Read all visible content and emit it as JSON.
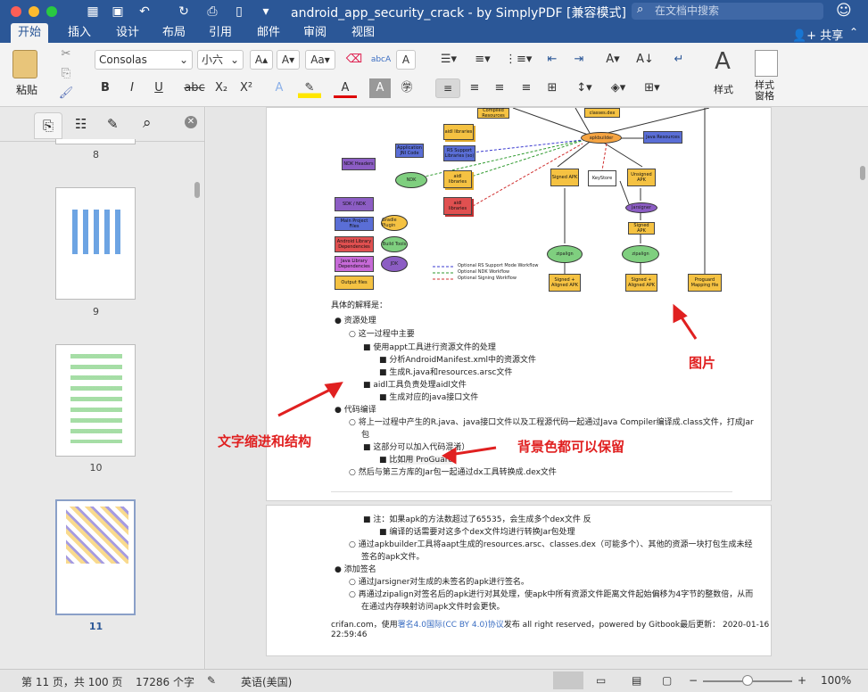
{
  "titlebar": {
    "title": "android_app_security_crack - by SimplyPDF [兼容模式]",
    "search_placeholder": "在文档中搜索"
  },
  "tabs": [
    "开始",
    "插入",
    "设计",
    "布局",
    "引用",
    "邮件",
    "审阅",
    "视图"
  ],
  "share_label": "共享",
  "ribbon": {
    "paste_label": "粘贴",
    "font_name": "Consolas",
    "font_size": "小六",
    "styles_label": "样式",
    "styles_pane_label": "样式\n窗格"
  },
  "thumbs": {
    "pages": [
      "8",
      "9",
      "10",
      "11"
    ]
  },
  "diagram": {
    "boxes": [
      "Compiled Resources",
      "classes.dex",
      "Java Resources",
      "aidl libraries",
      "RS Support Libraries (so)",
      "Application JNI Code",
      "NDK Headers",
      "aidl libraries",
      "aidl libraries",
      "Signed APK",
      "KeyStore",
      "Unsigned APK",
      "Signed APK",
      "SDK / NDK",
      "Main Project Files",
      "Android Library Dependencies",
      "Java Library Dependencies",
      "Output files",
      "Signed + Aligned APK",
      "Signed + Aligned APK",
      "Proguard Mapping file"
    ],
    "ellipses": [
      "apkbuilder",
      "NDK",
      "Jarsigner",
      "Gradle Plugin",
      "Build Tools",
      "JDK",
      "zipalign",
      "zipalign"
    ],
    "legend": [
      "Optional RS Support Mode Workflow",
      "Optional NDK Workflow",
      "Optional Signing Workflow"
    ]
  },
  "content": {
    "intro": "具体的解释是：",
    "l1": "资源处理",
    "l1a": "这一过程中主要",
    "l1a1": "使用appt工具进行资源文件的处理",
    "l1a1a": "分析AndroidManifest.xml中的资源文件",
    "l1a1b": "生成R.java和resources.arsc文件",
    "l1a2": "aidl工具负责处理aidl文件",
    "l1a2a": "生成对应的java接口文件",
    "l2": "代码编译",
    "l2a": "将上一过程中产生的R.java、java接口文件以及工程源代码一起通过Java Compiler编译成.class文件，打成Jar",
    "l2a_cont": "包",
    "l2a1": "这部分可以加入代码混淆）",
    "l2a1a": "比如用 ProGuard",
    "l2b": "然后与第三方库的Jar包一起通过dx工具转换成.dex文件"
  },
  "content2": {
    "n1": "注：如果apk的方法数超过了65535，会生成多个dex文件 反",
    "n1a": "编译的话需要对这多个dex文件均进行转换Jar包处理",
    "n2": "通过apkbuilder工具将aapt生成的resources.arsc、classes.dex（可能多个）、其他的资源一块打包生成未经",
    "n2c": "签名的apk文件。",
    "n3": "添加签名",
    "n3a": "通过Jarsigner对生成的未签名的apk进行签名。",
    "n3b": "再通过zipalign对签名后的apk进行对其处理，使apk中所有资源文件距离文件起始偏移为4字节的整数倍，从而",
    "n3b_cont": "在通过内存映射访问apk文件时会更快。",
    "footer1": "crifan.com，使用",
    "footer_link": "署名4.0国际(CC BY 4.0)协议",
    "footer2": "发布 all right reserved，powered by Gitbook最后更新： 2020-01-16",
    "footer3": "22:59:46"
  },
  "annotations": {
    "image": "图片",
    "indent": "文字缩进和结构",
    "bg": "背景色都可以保留"
  },
  "status": {
    "page": "第 11 页，共 100 页",
    "words": "17286 个字",
    "lang": "英语(美国)",
    "zoom": "100%"
  },
  "colors": {
    "accent": "#2b5797"
  }
}
